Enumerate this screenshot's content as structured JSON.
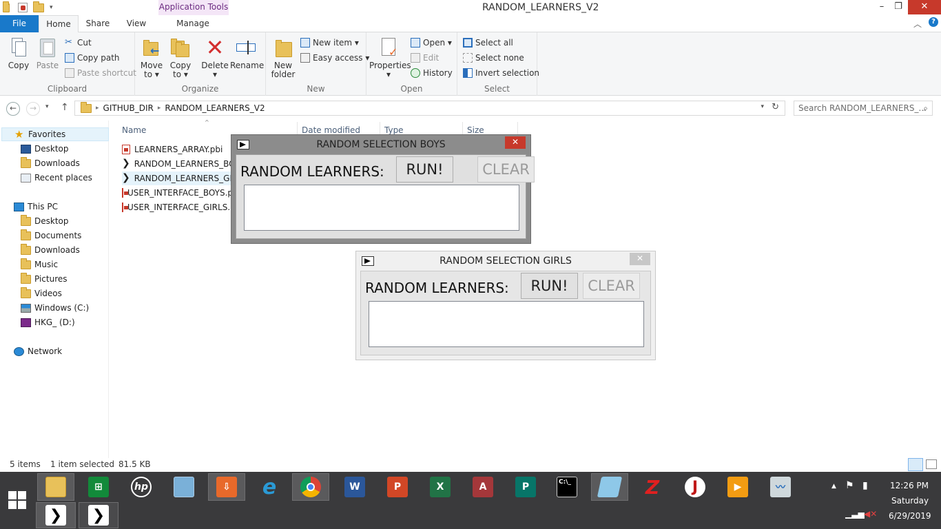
{
  "titlebar": {
    "context_tab": "Application Tools",
    "title": "RANDOM_LEARNERS_V2",
    "minimize": "–",
    "maximize": "❐",
    "close": "✕"
  },
  "ribbon_tabs": {
    "file": "File",
    "home": "Home",
    "share": "Share",
    "view": "View",
    "manage": "Manage"
  },
  "ribbon": {
    "clipboard": {
      "label": "Clipboard",
      "copy": "Copy",
      "paste": "Paste",
      "cut": "Cut",
      "copy_path": "Copy path",
      "paste_shortcut": "Paste shortcut"
    },
    "organize": {
      "label": "Organize",
      "move_to": "Move",
      "move_to_2": "to ▾",
      "copy_to": "Copy",
      "copy_to_2": "to ▾",
      "delete": "Delete",
      "delete_2": "▾",
      "rename": "Rename"
    },
    "new": {
      "label": "New",
      "new_folder": "New",
      "new_folder_2": "folder",
      "new_item": "New item ▾",
      "easy_access": "Easy access ▾"
    },
    "open": {
      "label": "Open",
      "properties": "Properties",
      "properties_2": "▾",
      "open": "Open ▾",
      "edit": "Edit",
      "history": "History"
    },
    "select": {
      "label": "Select",
      "select_all": "Select all",
      "select_none": "Select none",
      "invert_selection": "Invert selection"
    }
  },
  "address": {
    "crumbs": [
      "GITHUB_DIR",
      "RANDOM_LEARNERS_V2"
    ],
    "search_placeholder": "Search RANDOM_LEARNERS_..."
  },
  "nav": {
    "favorites": "Favorites",
    "fav_items": [
      "Desktop",
      "Downloads",
      "Recent places"
    ],
    "this_pc": "This PC",
    "pc_items": [
      "Desktop",
      "Documents",
      "Downloads",
      "Music",
      "Pictures",
      "Videos",
      "Windows (C:)",
      "HKG_ (D:)"
    ],
    "network": "Network"
  },
  "columns": {
    "name": "Name",
    "date_modified": "Date modified",
    "type": "Type",
    "size": "Size"
  },
  "files": [
    {
      "name": "LEARNERS_ARRAY.pbi",
      "kind": "pbi"
    },
    {
      "name": "RANDOM_LEARNERS_BOYS",
      "kind": "exe"
    },
    {
      "name": "RANDOM_LEARNERS_GIRLS",
      "kind": "exe"
    },
    {
      "name": "USER_INTERFACE_BOYS.pbi",
      "kind": "pbi"
    },
    {
      "name": "USER_INTERFACE_GIRLS.pbi",
      "kind": "pbi"
    }
  ],
  "status": {
    "items": "5 items",
    "selected": "1 item selected",
    "size": "81.5 KB"
  },
  "dialog_boys": {
    "title": "RANDOM SELECTION BOYS",
    "label": "RANDOM LEARNERS:",
    "run": "RUN!",
    "clear": "CLEAR",
    "close": "✕"
  },
  "dialog_girls": {
    "title": "RANDOM SELECTION GIRLS",
    "label": "RANDOM LEARNERS:",
    "run": "RUN!",
    "clear": "CLEAR",
    "close": "✕"
  },
  "taskbar": {
    "time": "12:26 PM",
    "day": "Saturday",
    "date": "6/29/2019",
    "apps": [
      {
        "name": "hp",
        "label": "hp",
        "color": "#3a3a3c"
      },
      {
        "name": "word",
        "label": "W",
        "color": "#2b579a"
      },
      {
        "name": "powerpoint",
        "label": "P",
        "color": "#d24726"
      },
      {
        "name": "excel",
        "label": "X",
        "color": "#217346"
      },
      {
        "name": "access",
        "label": "A",
        "color": "#a4373a"
      },
      {
        "name": "publisher",
        "label": "P",
        "color": "#077568"
      }
    ]
  },
  "colors": {
    "accent": "#1979ca",
    "close_red": "#c7392b",
    "taskbar": "#3a3a3c"
  }
}
